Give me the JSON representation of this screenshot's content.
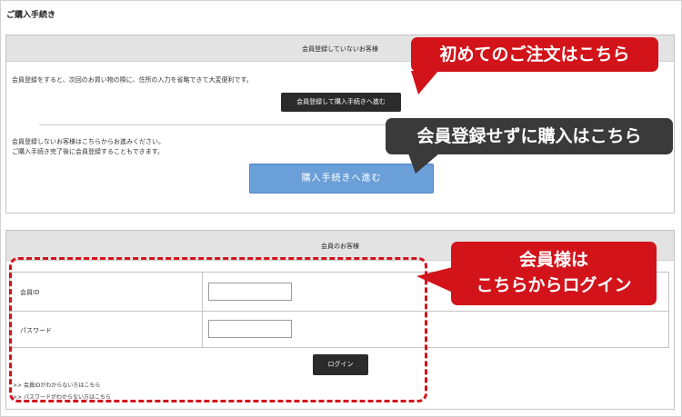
{
  "page": {
    "title": "ご購入手続き"
  },
  "guest": {
    "header": "会員登録していないお客様",
    "register_text": "会員登録をすると、次回のお買い物の際に、住所の入力を省略できて大変便利です。",
    "register_button": "会員登録して購入手続きへ進む",
    "guest_text_1": "会員登録しないお客様はこちらからお進みください。",
    "guest_text_2": "ご購入手続き完了後に会員登録することもできます。",
    "proceed_button": "購入手続きへ進む"
  },
  "member": {
    "header": "会員のお客様",
    "id_label": "会員ID",
    "password_label": "パスワード",
    "id_value": "",
    "password_value": "",
    "login_button": "ログイン",
    "forgot_id_link": ">>  会員IDがわからない方はこちら",
    "forgot_password_link": ">>  パスワードがわからない方はこちら"
  },
  "callouts": {
    "first_order": "初めてのご注文はこちら",
    "guest_purchase": "会員登録せずに購入はこちら",
    "member_login_line1": "会員様は",
    "member_login_line2": "こちらからログイン"
  },
  "colors": {
    "callout_red": "#d2131a",
    "callout_dark": "#3a3a3a",
    "proceed_blue": "#6a9fd8"
  }
}
